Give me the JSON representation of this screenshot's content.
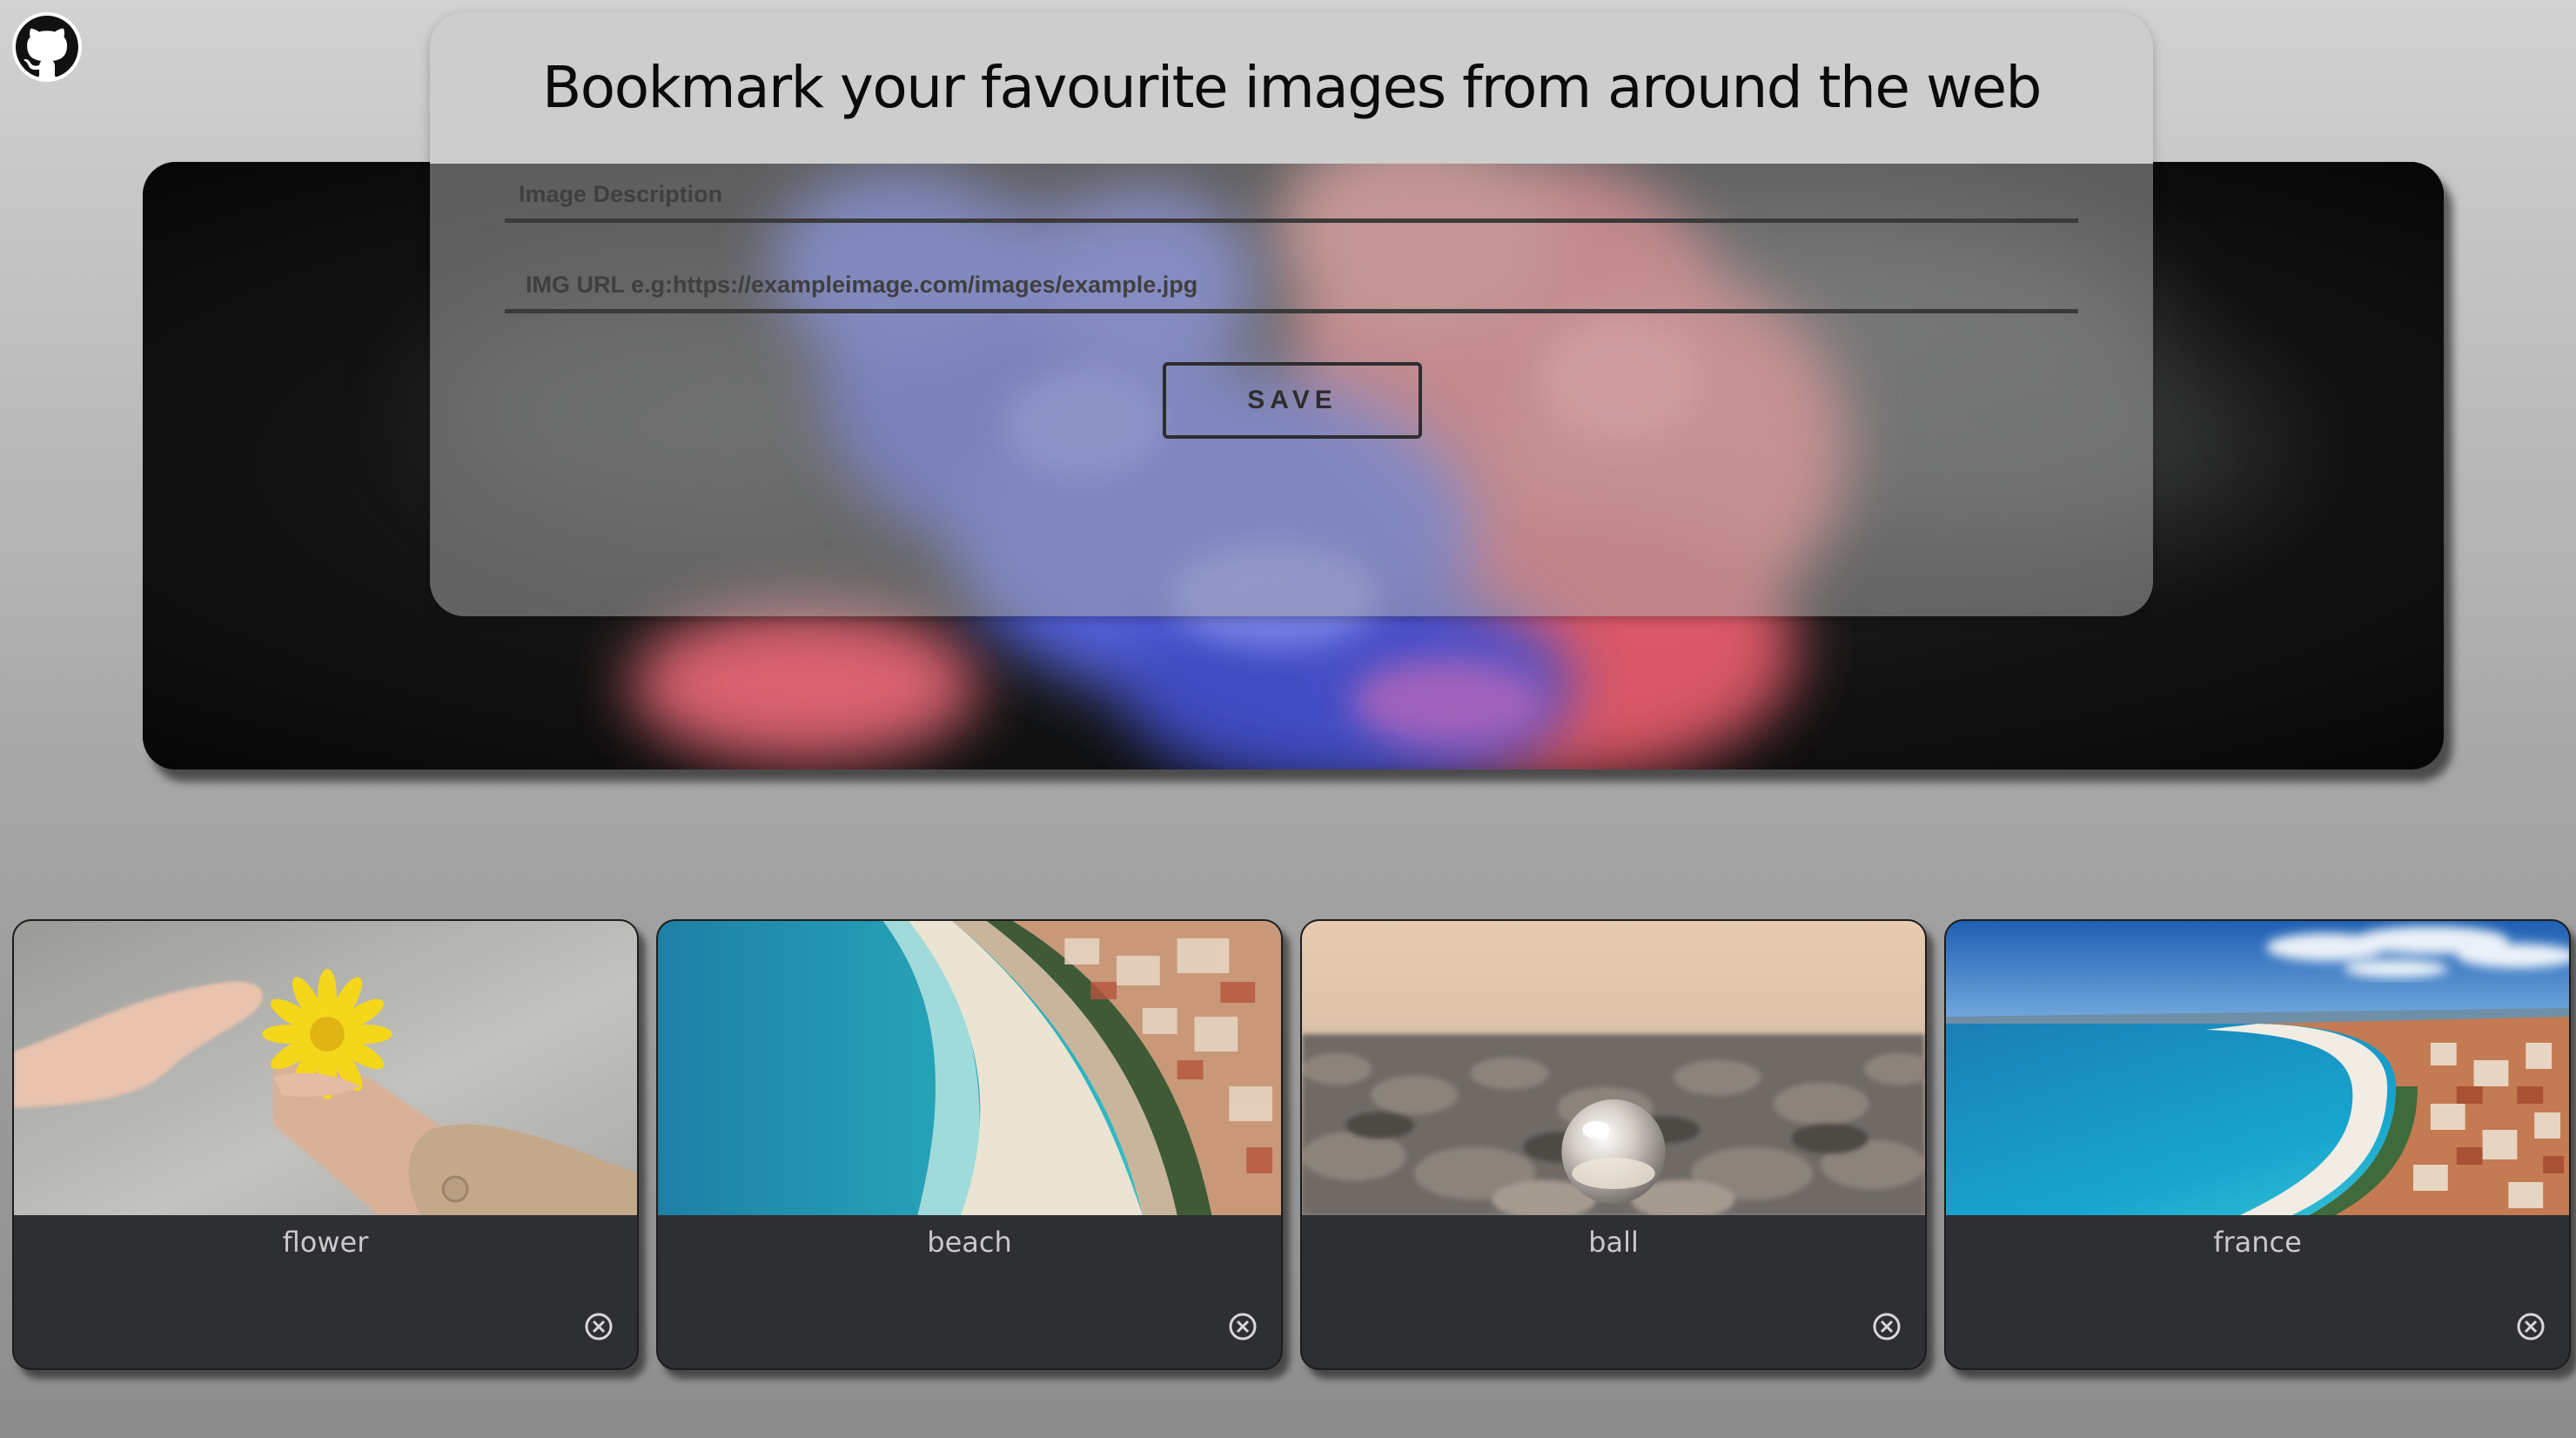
{
  "header": {
    "github_icon": "github-icon"
  },
  "form": {
    "title": "Bookmark your favourite images from around the web",
    "description_placeholder": "Image Description",
    "url_placeholder": "IMG URL e.g:https://exampleimage.com/images/example.jpg",
    "save_label": "SAVE"
  },
  "colors": {
    "smoke_blue": "#4a5bd8",
    "smoke_pink": "#f06a78",
    "card_background": "#2d2f33",
    "card_text": "#c9c9c9"
  },
  "bookmarks": [
    {
      "title": "flower",
      "image": "hands-holding-yellow-flower",
      "remove_icon": "close-circle-icon"
    },
    {
      "title": "beach",
      "image": "aerial-beach-coastline",
      "remove_icon": "close-circle-icon"
    },
    {
      "title": "ball",
      "image": "glass-ball-on-pebbles",
      "remove_icon": "close-circle-icon"
    },
    {
      "title": "france",
      "image": "bay-of-nice-aerial",
      "remove_icon": "close-circle-icon"
    }
  ]
}
